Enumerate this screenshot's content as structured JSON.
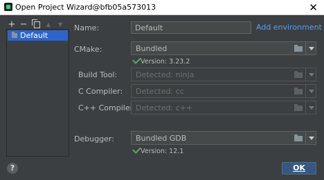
{
  "window": {
    "title": "Open Project Wizard@bfb05a573013",
    "close_glyph": "✕"
  },
  "toolbar": {
    "add_glyph": "+",
    "remove_glyph": "−",
    "up_glyph": "▲",
    "down_glyph": "▼"
  },
  "profiles": [
    {
      "label": "Default",
      "icon": "folder-icon",
      "selected": true
    }
  ],
  "form": {
    "name_label": "Name:",
    "name_value": "Default",
    "add_environment_label": "Add environment",
    "add_environment_caret": "⌄",
    "cmake_label": "CMake:",
    "cmake_value": "Bundled",
    "cmake_version": "Version: 3.23.2",
    "build_tool_label": "Build Tool:",
    "build_tool_value": "Detected: ninja",
    "c_compiler_label": "C Compiler:",
    "c_compiler_value": "Detected: cc",
    "cpp_compiler_label": "C++ Compiler:",
    "cpp_compiler_value": "Detected: c++",
    "debugger_label": "Debugger:",
    "debugger_value": "Bundled GDB",
    "debugger_version": "Version: 12.1"
  },
  "footer": {
    "help_glyph": "?",
    "ok_label": "OK"
  },
  "colors": {
    "background": "#3c3f41",
    "selection": "#2f65ca",
    "link": "#589df6",
    "check": "#59a869",
    "ok_button": "#365880"
  }
}
